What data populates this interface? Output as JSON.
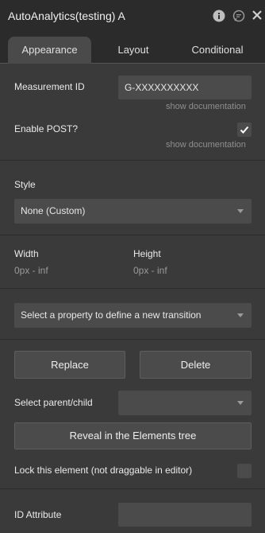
{
  "header": {
    "title": "AutoAnalytics(testing) A",
    "icons": [
      "info-icon",
      "comment-icon",
      "close-icon"
    ]
  },
  "tabs": [
    {
      "label": "Appearance",
      "active": true
    },
    {
      "label": "Layout",
      "active": false
    },
    {
      "label": "Conditional",
      "active": false
    }
  ],
  "measurement": {
    "label": "Measurement ID",
    "value": "G-XXXXXXXXXX",
    "doc_link": "show documentation"
  },
  "post": {
    "label": "Enable POST?",
    "checked": true,
    "doc_link": "show documentation"
  },
  "style": {
    "label": "Style",
    "selected": "None (Custom)"
  },
  "dimensions": {
    "width_label": "Width",
    "width_value": "0px - inf",
    "height_label": "Height",
    "height_value": "0px - inf"
  },
  "transition": {
    "placeholder": "Select a property to define a new transition"
  },
  "actions": {
    "replace_label": "Replace",
    "delete_label": "Delete",
    "parent_child_label": "Select parent/child",
    "parent_child_selected": "",
    "reveal_label": "Reveal in the Elements tree",
    "lock_label": "Lock this element (not draggable in editor)",
    "lock_checked": false
  },
  "id_attribute": {
    "label": "ID Attribute",
    "value": ""
  },
  "colors": {
    "panel_bg": "#3a3a3a",
    "header_bg": "#2b2b2b",
    "field_bg": "#4b4b4b",
    "muted_text": "#8f8f8f"
  }
}
